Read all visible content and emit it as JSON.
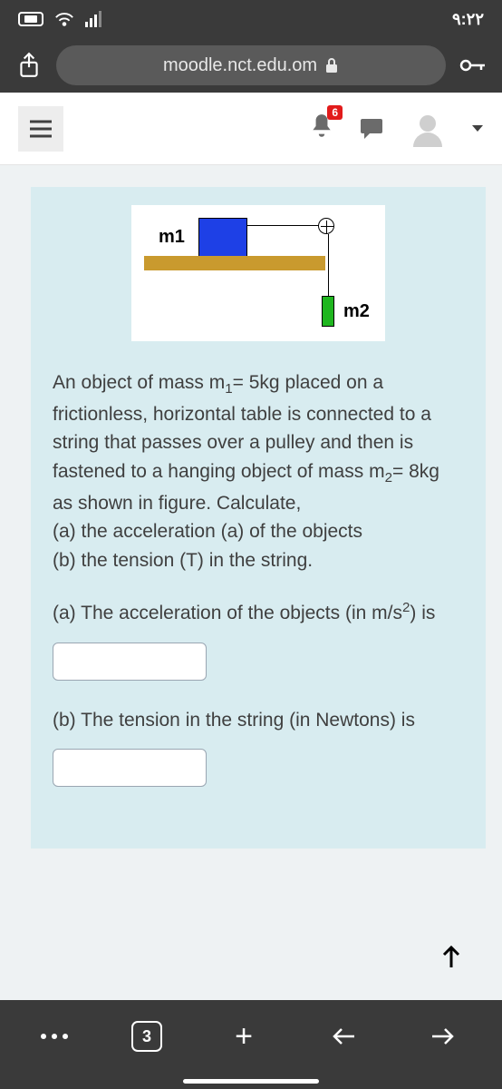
{
  "status": {
    "time": "٩:٢٢"
  },
  "browser": {
    "url": "moodle.nct.edu.om",
    "tab_count": "3"
  },
  "topbar": {
    "notification_badge": "6"
  },
  "figure": {
    "m1_label": "m1",
    "m2_label": "m2"
  },
  "question": {
    "text_1": "An object of mass m",
    "text_1_sub": "1",
    "text_2": "= 5kg placed on a frictionless, horizontal table is connected to a string that passes over a pulley and then is fastened to a hanging object of mass m",
    "text_2_sub": "2",
    "text_3": "= 8kg as shown in figure. Calculate,",
    "part_a_q": "(a) the acceleration (a) of the objects",
    "part_b_q": "(b) the tension (T) in the string.",
    "part_a_label_1": "(a) The acceleration of the objects (in m/s",
    "part_a_label_sup": "2",
    "part_a_label_2": ") is",
    "part_b_label": "(b) The tension in the string (in Newtons) is"
  },
  "inputs": {
    "answer_a": "",
    "answer_b": ""
  }
}
